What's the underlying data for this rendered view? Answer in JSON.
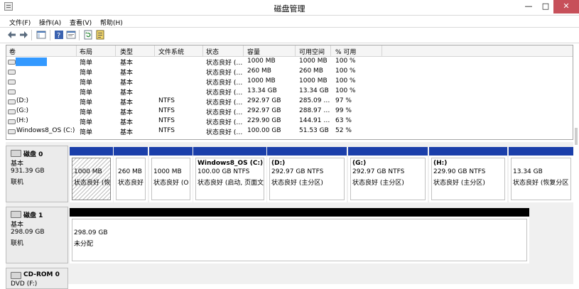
{
  "window": {
    "title": "磁盘管理",
    "min": "—",
    "max": "□",
    "close": "✕"
  },
  "menu": [
    "文件(F)",
    "操作(A)",
    "查看(V)",
    "帮助(H)"
  ],
  "volume_list": {
    "headers": [
      "卷",
      "布局",
      "类型",
      "文件系统",
      "状态",
      "容量",
      "可用空间",
      "% 可用"
    ],
    "rows": [
      {
        "vol": "",
        "layout": "简单",
        "type": "基本",
        "fs": "",
        "status": "状态良好 (…",
        "cap": "1000 MB",
        "free": "1000 MB",
        "pct": "100 %"
      },
      {
        "vol": "",
        "layout": "简单",
        "type": "基本",
        "fs": "",
        "status": "状态良好 (…",
        "cap": "260 MB",
        "free": "260 MB",
        "pct": "100 %"
      },
      {
        "vol": "",
        "layout": "简单",
        "type": "基本",
        "fs": "",
        "status": "状态良好 (…",
        "cap": "1000 MB",
        "free": "1000 MB",
        "pct": "100 %"
      },
      {
        "vol": "",
        "layout": "简单",
        "type": "基本",
        "fs": "",
        "status": "状态良好 (…",
        "cap": "13.34 GB",
        "free": "13.34 GB",
        "pct": "100 %"
      },
      {
        "vol": "(D:)",
        "layout": "简单",
        "type": "基本",
        "fs": "NTFS",
        "status": "状态良好 (…",
        "cap": "292.97 GB",
        "free": "285.09 …",
        "pct": "97 %"
      },
      {
        "vol": "(G:)",
        "layout": "简单",
        "type": "基本",
        "fs": "NTFS",
        "status": "状态良好 (…",
        "cap": "292.97 GB",
        "free": "288.97 …",
        "pct": "99 %"
      },
      {
        "vol": "(H:)",
        "layout": "简单",
        "type": "基本",
        "fs": "NTFS",
        "status": "状态良好 (…",
        "cap": "229.90 GB",
        "free": "144.91 …",
        "pct": "63 %"
      },
      {
        "vol": "Windows8_OS (C:)",
        "layout": "简单",
        "type": "基本",
        "fs": "NTFS",
        "status": "状态良好 (…",
        "cap": "100.00 GB",
        "free": "51.53 GB",
        "pct": "52 %"
      }
    ]
  },
  "disks": [
    {
      "name": "磁盘 0",
      "type": "基本",
      "size": "931.39 GB",
      "state": "联机",
      "partitions": [
        {
          "name": "",
          "size": "1000 MB",
          "status": "状态良好 (恢"
        },
        {
          "name": "",
          "size": "260 MB",
          "status": "状态良好"
        },
        {
          "name": "",
          "size": "1000 MB",
          "status": "状态良好 (O"
        },
        {
          "name": "Windows8_OS  (C:)",
          "size": "100.00 GB NTFS",
          "status": "状态良好 (启动, 页面文"
        },
        {
          "name": "(D:)",
          "size": "292.97 GB NTFS",
          "status": "状态良好 (主分区)"
        },
        {
          "name": "(G:)",
          "size": "292.97 GB NTFS",
          "status": "状态良好 (主分区)"
        },
        {
          "name": "(H:)",
          "size": "229.90 GB NTFS",
          "status": "状态良好 (主分区)"
        },
        {
          "name": "",
          "size": "13.34 GB",
          "status": "状态良好 (恢复分区"
        }
      ]
    },
    {
      "name": "磁盘 1",
      "type": "基本",
      "size": "298.09 GB",
      "state": "联机",
      "partitions": [
        {
          "size": "298.09 GB",
          "status": "未分配"
        }
      ]
    },
    {
      "name": "CD-ROM 0",
      "type": "DVD (F:)"
    }
  ],
  "colors": {
    "primary_bar": "#1b3faa",
    "unallocated_bar": "#000000",
    "selection": "#3399ff",
    "close_button": "#c7505a"
  }
}
